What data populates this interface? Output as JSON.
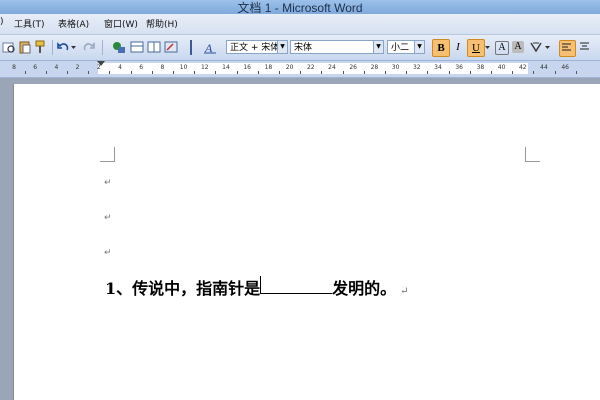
{
  "titlebar": {
    "title": "文档 1 - Microsoft Word"
  },
  "menu": {
    "items": [
      {
        "label": ")"
      },
      {
        "label": "工具(T)"
      },
      {
        "label": "表格(A)"
      },
      {
        "label": "窗口(W)"
      },
      {
        "label": "帮助(H)"
      }
    ]
  },
  "toolbar": {
    "style_value": "正文 + 宋体",
    "font_value": "宋体",
    "size_value": "小二",
    "bold_label": "B",
    "italic_label": "I",
    "underline_label": "U",
    "a_label": "A",
    "aa_label": "A"
  },
  "ruler": {
    "ticks": [
      "8",
      "6",
      "4",
      "2",
      "2",
      "4",
      "6",
      "8",
      "10",
      "12",
      "14",
      "16",
      "18",
      "20",
      "22",
      "24",
      "26",
      "28",
      "30",
      "32",
      "34",
      "36",
      "38",
      "40",
      "42",
      "44",
      "46"
    ]
  },
  "document": {
    "line_before": "1、传说中，指南针是",
    "line_after": "发明的。",
    "para_mark": "↵"
  },
  "colors": {
    "accent": "#f0a020",
    "toolbar": "#c9d8ef",
    "workspace": "#9aa6b8"
  }
}
